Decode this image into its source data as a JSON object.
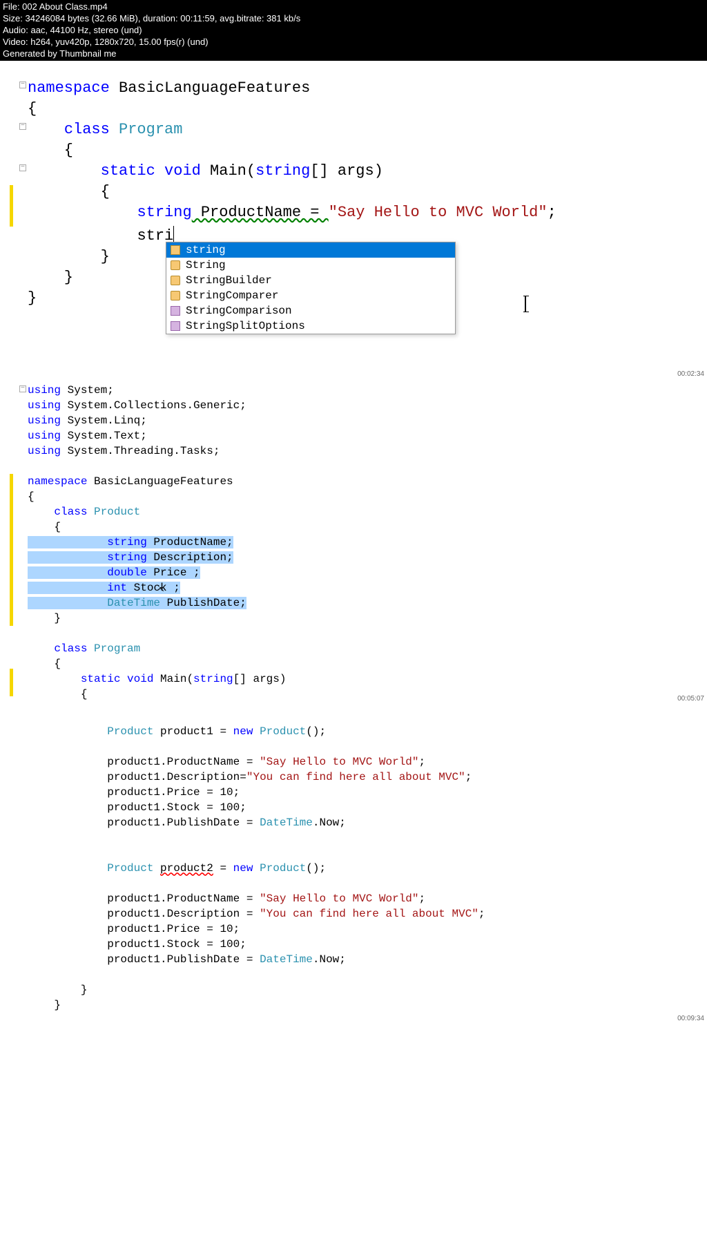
{
  "header": {
    "l1": "File: 002 About Class.mp4",
    "l2": "Size: 34246084 bytes (32.66 MiB), duration: 00:11:59, avg.bitrate: 381 kb/s",
    "l3": "Audio: aac, 44100 Hz, stereo (und)",
    "l4": "Video: h264, yuv420p, 1280x720, 15.00 fps(r) (und)",
    "l5": "Generated by Thumbnail me"
  },
  "frame1": {
    "code": {
      "ns": "namespace",
      "nsname": " BasicLanguageFeatures",
      "ob": "{",
      "cls": "class",
      "clsname": " Program",
      "ob2": "    {",
      "static": "static",
      "void": " void",
      "main": " Main(",
      "string": "string",
      "args": "[] args)",
      "ob3": "        {",
      "stringkw": "string",
      "pname": " ProductName = ",
      "strval": "\"Say Hello to MVC World\"",
      "semi": ";",
      "typed": "stri",
      "cb3": "        }",
      "cb2": "    }",
      "cb1": "}"
    },
    "intellisense": {
      "i1": "string",
      "i2": "String",
      "i3": "StringBuilder",
      "i4": "StringComparer",
      "i5": "StringComparison",
      "i6": "StringSplitOptions"
    },
    "timestamp": "00:02:34"
  },
  "frame2": {
    "usings": {
      "u": "using",
      "u1": " System;",
      "u2": " System.Collections.Generic;",
      "u3": " System.Linq;",
      "u4": " System.Text;",
      "u5": " System.Threading.Tasks;"
    },
    "ns": "namespace",
    "nsname": " BasicLanguageFeatures",
    "ob": "{",
    "cls": "class",
    "product": " Product",
    "ob2": "    {",
    "fields": {
      "string": "string",
      "pname": " ProductName;",
      "desc": " Description;",
      "double": "double",
      "price": " Price ;",
      "int": "int",
      "stock": " Stock ;",
      "dt": "DateTime",
      "pub": " PublishDate;"
    },
    "cb2": "    }",
    "program": " Program",
    "ob3": "    {",
    "static": "static",
    "void": " void",
    "main": " Main(",
    "stringkw": "string",
    "args": "[] args)",
    "ob4": "        {",
    "body": {
      "prod": "Product",
      "p1": " product1 = ",
      "new": "new",
      "prodctor": " Product",
      "parens": "();",
      "l1": "            product1.ProductName = ",
      "s1": "\"Say Hello to MVC World\"",
      "l2": "            product1.Description=",
      "s2": "\"You can find here all about MVC\"",
      "l3": "            product1.Price = 10;",
      "l4": "            product1.Stock = 100;",
      "l5": "            product1.PublishDate = ",
      "dt": "DateTime",
      "now": ".Now;",
      "p2": " product2 = ",
      "l6": "            product1.ProductName = ",
      "l7": "            product1.Description = ",
      "l8": "            product1.Price = 10;",
      "l9a": "            product1.Stock = 1",
      "l9b": "0;",
      "zero": "0",
      "l10": "            product1.PublishDate = "
    },
    "cb4": "        }",
    "cb3": "    }",
    "ts1": "00:05:07",
    "ts2": "00:09:34"
  }
}
